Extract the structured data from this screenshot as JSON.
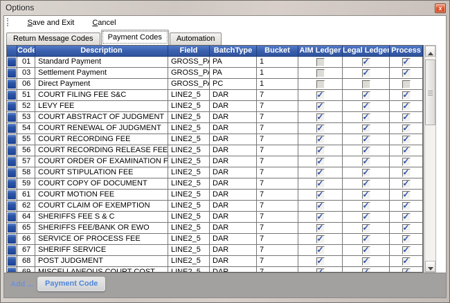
{
  "window": {
    "title": "Options",
    "close_glyph": "x"
  },
  "menu": {
    "items": [
      {
        "label": "Save and Exit",
        "underline_index": 0
      },
      {
        "label": "Cancel",
        "underline_index": 0
      }
    ]
  },
  "tabs": [
    {
      "label": "Return Message Codes",
      "active": false
    },
    {
      "label": "Payment Codes",
      "active": true
    },
    {
      "label": "Automation",
      "active": false
    }
  ],
  "grid": {
    "columns": [
      "Code",
      "Description",
      "Field",
      "BatchType",
      "Bucket",
      "AIM Ledger",
      "Legal Ledger",
      "Process"
    ],
    "rows": [
      {
        "code": "01",
        "description": "Standard Payment",
        "field": "GROSS_PAY",
        "batch_type": "PA",
        "bucket": "1",
        "aim_ledger": false,
        "legal_ledger": true,
        "process": true
      },
      {
        "code": "03",
        "description": "Settlement Payment",
        "field": "GROSS_PAY",
        "batch_type": "PA",
        "bucket": "1",
        "aim_ledger": false,
        "legal_ledger": true,
        "process": true
      },
      {
        "code": "06",
        "description": "Direct Payment",
        "field": "GROSS_PAY",
        "batch_type": "PC",
        "bucket": "1",
        "aim_ledger": false,
        "legal_ledger": false,
        "process": false
      },
      {
        "code": "51",
        "description": "COURT FILING FEE S&C",
        "field": "LINE2_5",
        "batch_type": "DAR",
        "bucket": "7",
        "aim_ledger": true,
        "legal_ledger": true,
        "process": true
      },
      {
        "code": "52",
        "description": "LEVY FEE",
        "field": "LINE2_5",
        "batch_type": "DAR",
        "bucket": "7",
        "aim_ledger": true,
        "legal_ledger": true,
        "process": true
      },
      {
        "code": "53",
        "description": "COURT ABSTRACT OF JUDGMENT",
        "field": "LINE2_5",
        "batch_type": "DAR",
        "bucket": "7",
        "aim_ledger": true,
        "legal_ledger": true,
        "process": true
      },
      {
        "code": "54",
        "description": "COURT RENEWAL OF JUDGMENT",
        "field": "LINE2_5",
        "batch_type": "DAR",
        "bucket": "7",
        "aim_ledger": true,
        "legal_ledger": true,
        "process": true
      },
      {
        "code": "55",
        "description": "COURT RECORDING FEE",
        "field": "LINE2_5",
        "batch_type": "DAR",
        "bucket": "7",
        "aim_ledger": true,
        "legal_ledger": true,
        "process": true
      },
      {
        "code": "56",
        "description": "COURT RECORDING RELEASE FEE",
        "field": "LINE2_5",
        "batch_type": "DAR",
        "bucket": "7",
        "aim_ledger": true,
        "legal_ledger": true,
        "process": true
      },
      {
        "code": "57",
        "description": "COURT ORDER OF EXAMINATION FEE",
        "field": "LINE2_5",
        "batch_type": "DAR",
        "bucket": "7",
        "aim_ledger": true,
        "legal_ledger": true,
        "process": true
      },
      {
        "code": "58",
        "description": "COURT STIPULATION FEE",
        "field": "LINE2_5",
        "batch_type": "DAR",
        "bucket": "7",
        "aim_ledger": true,
        "legal_ledger": true,
        "process": true
      },
      {
        "code": "59",
        "description": "COURT COPY OF DOCUMENT",
        "field": "LINE2_5",
        "batch_type": "DAR",
        "bucket": "7",
        "aim_ledger": true,
        "legal_ledger": true,
        "process": true
      },
      {
        "code": "61",
        "description": "COURT MOTION FEE",
        "field": "LINE2_5",
        "batch_type": "DAR",
        "bucket": "7",
        "aim_ledger": true,
        "legal_ledger": true,
        "process": true
      },
      {
        "code": "62",
        "description": "COURT CLAIM OF EXEMPTION",
        "field": "LINE2_5",
        "batch_type": "DAR",
        "bucket": "7",
        "aim_ledger": true,
        "legal_ledger": true,
        "process": true
      },
      {
        "code": "64",
        "description": "SHERIFFS FEE S & C",
        "field": "LINE2_5",
        "batch_type": "DAR",
        "bucket": "7",
        "aim_ledger": true,
        "legal_ledger": true,
        "process": true
      },
      {
        "code": "65",
        "description": "SHERIFFS FEE/BANK OR EWO",
        "field": "LINE2_5",
        "batch_type": "DAR",
        "bucket": "7",
        "aim_ledger": true,
        "legal_ledger": true,
        "process": true
      },
      {
        "code": "66",
        "description": "SERVICE OF PROCESS FEE",
        "field": "LINE2_5",
        "batch_type": "DAR",
        "bucket": "7",
        "aim_ledger": true,
        "legal_ledger": true,
        "process": true
      },
      {
        "code": "67",
        "description": "SHERIFF SERVICE",
        "field": "LINE2_5",
        "batch_type": "DAR",
        "bucket": "7",
        "aim_ledger": true,
        "legal_ledger": true,
        "process": true
      },
      {
        "code": "68",
        "description": "POST JUDGMENT",
        "field": "LINE2_5",
        "batch_type": "DAR",
        "bucket": "7",
        "aim_ledger": true,
        "legal_ledger": true,
        "process": true
      },
      {
        "code": "69",
        "description": "MISCELLANEOUS COURT COST",
        "field": "LINE2_5",
        "batch_type": "DAR",
        "bucket": "7",
        "aim_ledger": true,
        "legal_ledger": true,
        "process": true
      }
    ]
  },
  "footer": {
    "add_label": "Add ...",
    "button_label": "Payment Code"
  },
  "colors": {
    "header_blue_top": "#537ac8",
    "header_blue_bottom": "#30549c",
    "check_blue": "#2b50a8",
    "footer_gray": "#a3a1a0",
    "add_link_blue": "#7191d6",
    "button_text_blue": "#4f86d8",
    "close_button_red": "#d95b2e"
  }
}
